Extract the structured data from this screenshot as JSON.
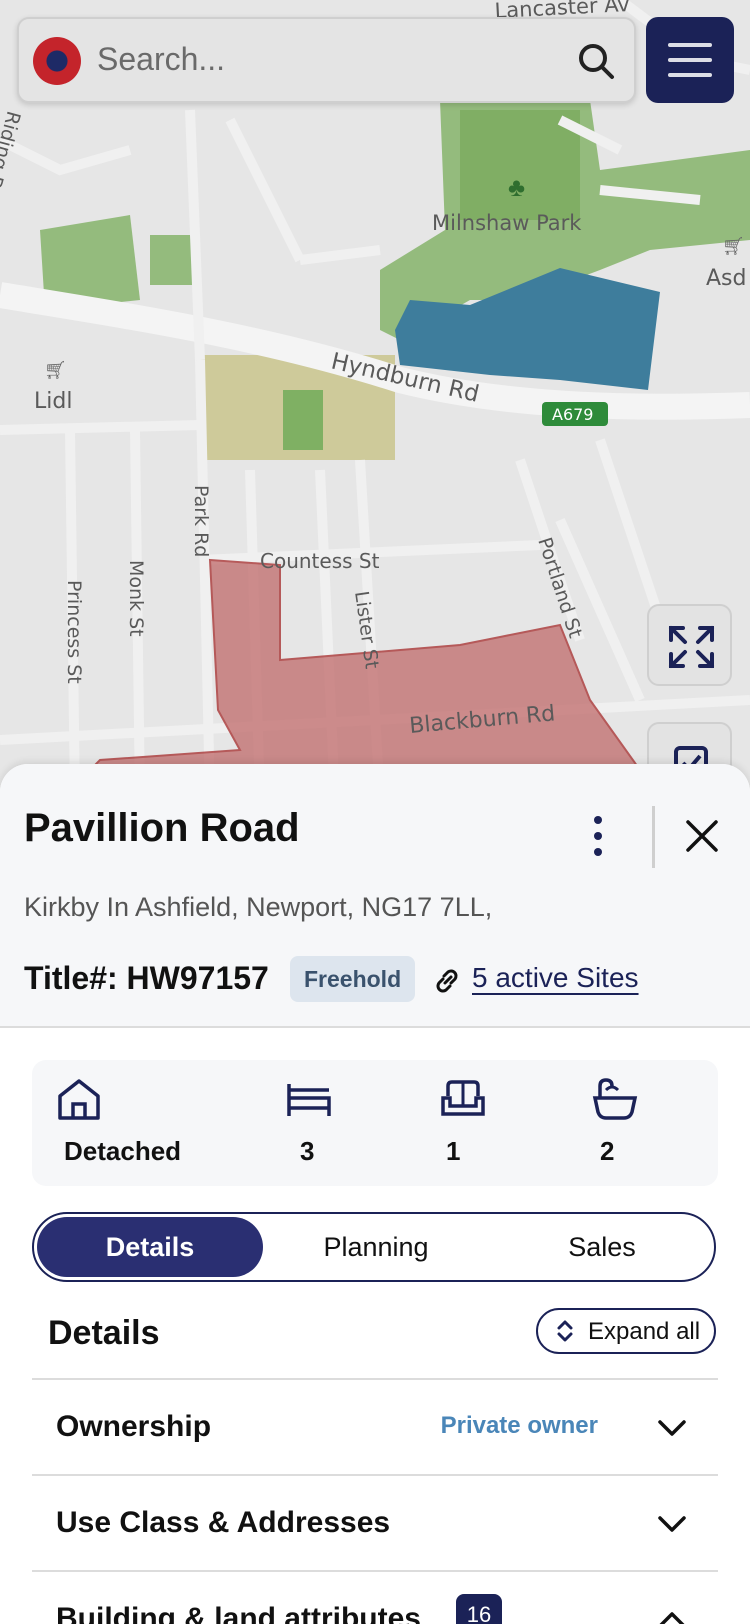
{
  "search": {
    "placeholder": "Search..."
  },
  "map": {
    "labels": {
      "park": "Milnshaw Park",
      "road_main": "Hyndburn Rd",
      "road_shield": "A679",
      "lidl": "Lidl",
      "asda": "Asd",
      "park_rd": "Park Rd",
      "countess": "Countess St",
      "monk": "Monk St",
      "princess": "Princess St",
      "lister": "Lister St",
      "portland": "Portland St",
      "blackburn": "Blackburn Rd",
      "lancaster": "Lancaster Av",
      "riding_barn": "Riding Barn"
    },
    "colors": {
      "water": "#3e7d9c",
      "park": "#7fb063",
      "site": "#c06a6a",
      "road": "#f2f2f2"
    }
  },
  "property": {
    "name": "Pavillion Road",
    "address": "Kirkby In Ashfield, Newport, NG17 7LL,",
    "title_number": "Title#: HW97157",
    "tenure": "Freehold",
    "sites_link": "5 active Sites"
  },
  "features": [
    {
      "icon": "house-icon",
      "value": "Detached"
    },
    {
      "icon": "bed-icon",
      "value": "3"
    },
    {
      "icon": "sofa-icon",
      "value": "1"
    },
    {
      "icon": "bathtub-icon",
      "value": "2"
    }
  ],
  "tabs": [
    "Details",
    "Planning",
    "Sales"
  ],
  "details": {
    "heading": "Details",
    "expand_all": "Expand all",
    "sections": [
      {
        "label": "Ownership",
        "meta": "Private owner"
      },
      {
        "label": "Use Class & Addresses",
        "meta": ""
      },
      {
        "label": "Building & land attributes",
        "count": "16"
      }
    ]
  }
}
